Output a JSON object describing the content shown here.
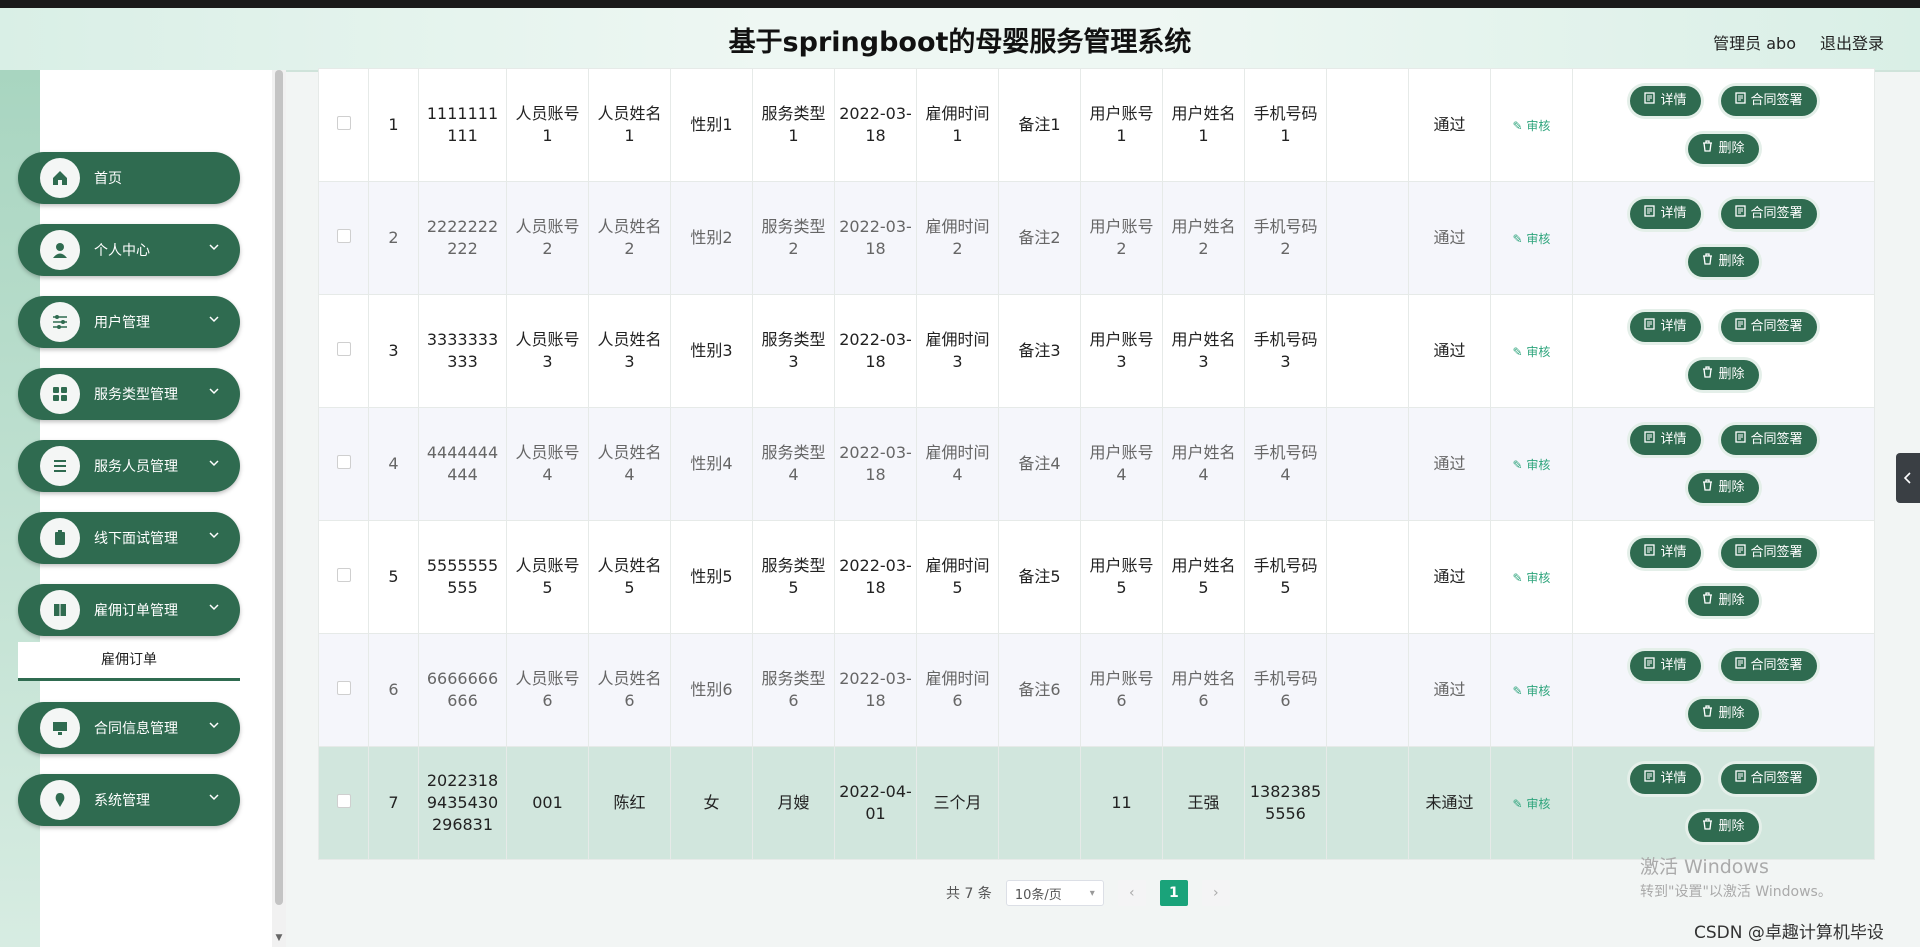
{
  "app": {
    "title": "基于springboot的母婴服务管理系统",
    "user": "管理员 abo",
    "logout": "退出登录"
  },
  "sidebar": {
    "items": [
      {
        "label": "首页",
        "icon": "home-icon",
        "expandable": false
      },
      {
        "label": "个人中心",
        "icon": "person-icon",
        "expandable": true
      },
      {
        "label": "用户管理",
        "icon": "sliders-icon",
        "expandable": true
      },
      {
        "label": "服务类型管理",
        "icon": "grid-icon",
        "expandable": true
      },
      {
        "label": "服务人员管理",
        "icon": "list-icon",
        "expandable": true
      },
      {
        "label": "线下面试管理",
        "icon": "clipboard-icon",
        "expandable": true
      },
      {
        "label": "雇佣订单管理",
        "icon": "book-icon",
        "expandable": true
      },
      {
        "label": "合同信息管理",
        "icon": "monitor-icon",
        "expandable": true
      },
      {
        "label": "系统管理",
        "icon": "pin-icon",
        "expandable": true
      }
    ],
    "submenu": {
      "label": "雇佣订单"
    }
  },
  "table": {
    "rows": [
      {
        "idx": "1",
        "order": "1111111111",
        "account": "人员账号1",
        "name": "人员姓名1",
        "gender": "性别1",
        "type": "服务类型1",
        "date": "2022-03-18",
        "duration": "雇佣时间1",
        "remark": "备注1",
        "uacc": "用户账号1",
        "uname": "用户姓名1",
        "phone": "手机号码1",
        "extra": "",
        "status": "通过"
      },
      {
        "idx": "2",
        "order": "2222222222",
        "account": "人员账号2",
        "name": "人员姓名2",
        "gender": "性别2",
        "type": "服务类型2",
        "date": "2022-03-18",
        "duration": "雇佣时间2",
        "remark": "备注2",
        "uacc": "用户账号2",
        "uname": "用户姓名2",
        "phone": "手机号码2",
        "extra": "",
        "status": "通过"
      },
      {
        "idx": "3",
        "order": "3333333333",
        "account": "人员账号3",
        "name": "人员姓名3",
        "gender": "性别3",
        "type": "服务类型3",
        "date": "2022-03-18",
        "duration": "雇佣时间3",
        "remark": "备注3",
        "uacc": "用户账号3",
        "uname": "用户姓名3",
        "phone": "手机号码3",
        "extra": "",
        "status": "通过"
      },
      {
        "idx": "4",
        "order": "4444444444",
        "account": "人员账号4",
        "name": "人员姓名4",
        "gender": "性别4",
        "type": "服务类型4",
        "date": "2022-03-18",
        "duration": "雇佣时间4",
        "remark": "备注4",
        "uacc": "用户账号4",
        "uname": "用户姓名4",
        "phone": "手机号码4",
        "extra": "",
        "status": "通过"
      },
      {
        "idx": "5",
        "order": "5555555555",
        "account": "人员账号5",
        "name": "人员姓名5",
        "gender": "性别5",
        "type": "服务类型5",
        "date": "2022-03-18",
        "duration": "雇佣时间5",
        "remark": "备注5",
        "uacc": "用户账号5",
        "uname": "用户姓名5",
        "phone": "手机号码5",
        "extra": "",
        "status": "通过"
      },
      {
        "idx": "6",
        "order": "6666666666",
        "account": "人员账号6",
        "name": "人员姓名6",
        "gender": "性别6",
        "type": "服务类型6",
        "date": "2022-03-18",
        "duration": "雇佣时间6",
        "remark": "备注6",
        "uacc": "用户账号6",
        "uname": "用户姓名6",
        "phone": "手机号码6",
        "extra": "",
        "status": "通过"
      },
      {
        "idx": "7",
        "order": "20223189435430296831",
        "account": "001",
        "name": "陈红",
        "gender": "女",
        "type": "月嫂",
        "date": "2022-04-01",
        "duration": "三个月",
        "remark": "",
        "uacc": "11",
        "uname": "王强",
        "phone": "13823855556",
        "extra": "",
        "status": "未通过"
      }
    ],
    "audit_label": "审核",
    "buttons": {
      "detail": "详情",
      "contract": "合同签署",
      "delete": "删除"
    }
  },
  "pagination": {
    "total": "共 7 条",
    "page_size": "10条/页",
    "current": "1"
  },
  "watermark": {
    "line1": "激活 Windows",
    "line2": "转到\"设置\"以激活 Windows。"
  },
  "csdn": "CSDN @卓趣计算机毕设",
  "colors": {
    "primary": "#2f6b50",
    "accent": "#1aa37a",
    "selected_row": "#d1e6dd"
  }
}
